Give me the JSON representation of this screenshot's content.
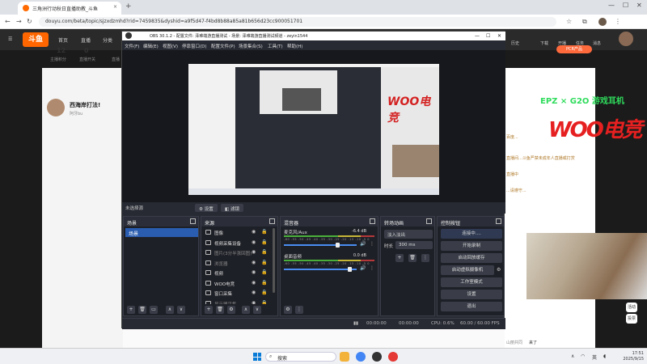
{
  "browser": {
    "tab_title": "三角洲行动秋日直播助教_斗鱼",
    "url": "douyu.com/beta/topic/sjzxdzmhd?rid=7459835&dyshid=a9f5d47-f4bd8b88a85a81b656d23cc900051701",
    "user_avatar": "avatar"
  },
  "site": {
    "logo": "斗鱼",
    "nav": [
      "首页",
      "直播",
      "分类"
    ],
    "header_right": [
      "历史",
      "下载",
      "开播",
      "任务",
      "消息"
    ],
    "stats": [
      {
        "value": "12",
        "label": "主播积分"
      },
      {
        "value": "0",
        "label": "直播开关"
      },
      {
        "value": "",
        "label": "直播"
      }
    ],
    "streamer_name": "西海岸打法!",
    "streamer_sub": "阿牙bu",
    "pcr_badge": "PCR产品",
    "epz": "EPZ × G2O 游戏耳机",
    "woo": "WOO电竞",
    "right_lines": [
      "冒海...",
      "百度...",
      "...",
      "直播间...斗鱼严禁未成年人直播或打赏",
      "直播中",
      "...",
      "...请遵守..."
    ],
    "chat_user": "山丽共同",
    "chat_text": "来了",
    "side_buttons": [
      "活动",
      "投票"
    ]
  },
  "obs": {
    "title": "OBS 30.1.2 - 配置文件: 泽难端游直播测试 - 场景: 泽难端游直播测试频道 - zeyin1544",
    "menu": [
      "文件(F)",
      "编辑(E)",
      "视图(V)",
      "停靠窗口(D)",
      "配置文件(P)",
      "场景集合(S)",
      "工具(T)",
      "帮助(H)"
    ],
    "scenebar_label": "未选择源",
    "settings_btn": "设置",
    "filter_btn": "滤镜",
    "scenes": {
      "title": "场景",
      "items": [
        "场景"
      ]
    },
    "sources": {
      "title": "来源",
      "items": [
        {
          "name": "图像",
          "dim": false
        },
        {
          "name": "视频采集设备",
          "dim": false
        },
        {
          "name": "图片(3分半涨回图)",
          "dim": true
        },
        {
          "name": "浏览器",
          "dim": true
        },
        {
          "name": "视频",
          "dim": false
        },
        {
          "name": "WOO电竞",
          "dim": false
        },
        {
          "name": "窗口采集",
          "dim": false
        },
        {
          "name": "显示器采集",
          "dim": true
        }
      ]
    },
    "mixer": {
      "title": "混音器",
      "channels": [
        {
          "name": "麦克风/Aux",
          "db": "-6.4 dB",
          "level": 0.73
        },
        {
          "name": "桌面音频",
          "db": "0.0 dB",
          "level": 0.9
        }
      ],
      "scale": "-60 -55 -50 -45 -40 -35 -30 -25 -20 -15 -10 -5 0"
    },
    "transitions": {
      "title": "转场动画",
      "selected": "淡入淡出",
      "duration_label": "时长",
      "duration": "300 ms"
    },
    "controls": {
      "title": "控制按钮",
      "buttons": [
        "连接中....",
        "开始录制",
        "启动回放缓存",
        "启动虚拟摄像机",
        "工作室模式",
        "设置",
        "退出"
      ]
    },
    "status": {
      "time1": "00:00:00",
      "time2": "00:00:00",
      "cpu": "CPU: 0.6%",
      "fps": "60.00 / 60.00 FPS"
    }
  },
  "taskbar": {
    "search": "搜索",
    "tray_lang": "英",
    "time": "17:51",
    "date": "2025/9/15"
  }
}
